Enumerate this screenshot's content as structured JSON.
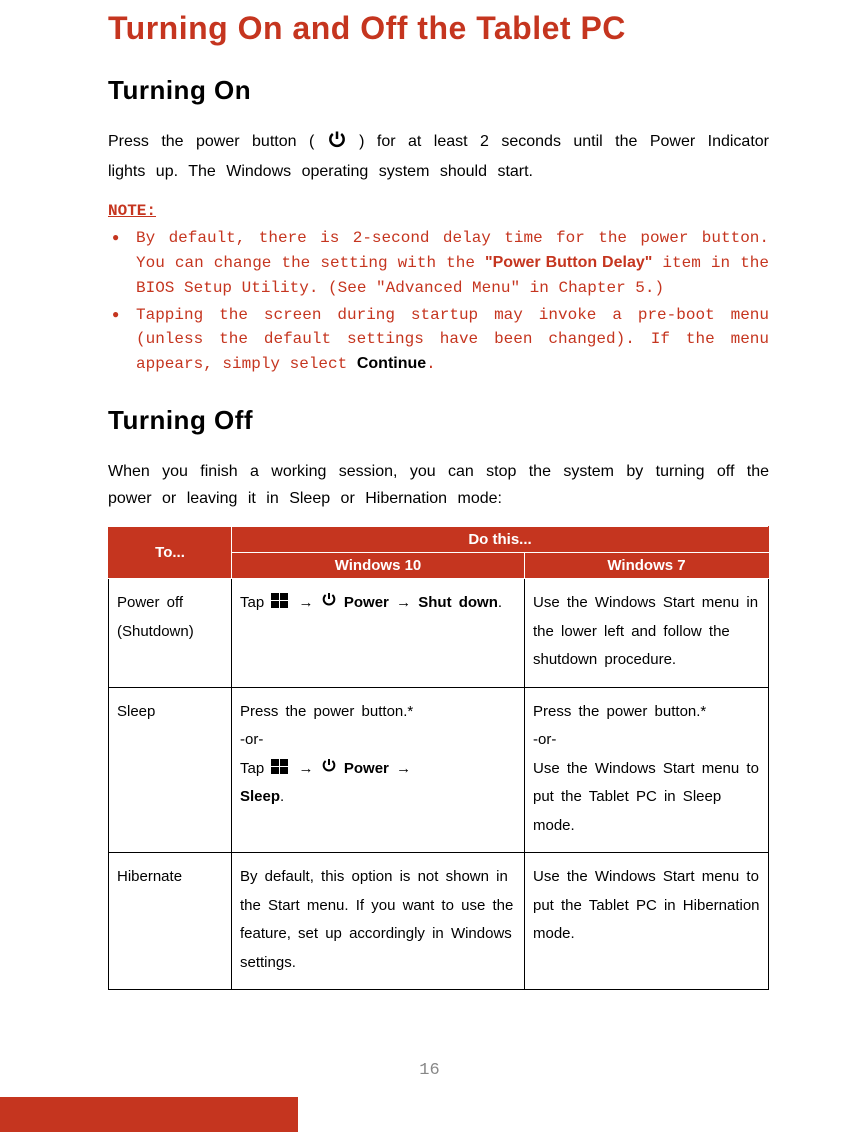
{
  "title": "Turning On and Off the Tablet PC",
  "section1": {
    "heading": "Turning On",
    "para_before": "Press the power button ( ",
    "para_after": " ) for at least 2 seconds until the Power Indicator lights up. The Windows operating system should start."
  },
  "note": {
    "label": "NOTE:",
    "items": [
      {
        "pre": "By default, there is 2-second delay time for the power button. You can change the setting with the ",
        "bold": "\"Power Button Delay\"",
        "post": " item in the BIOS Setup Utility. (See \"Advanced Menu\" in Chapter 5.)"
      },
      {
        "pre": "Tapping the screen during startup may invoke a pre-boot menu (unless the default settings have been changed). If the menu appears, simply select ",
        "bold": "Continue",
        "post": "."
      }
    ]
  },
  "section2": {
    "heading": "Turning Off",
    "para": "When you finish a working session, you can stop the system by turning off the power or leaving it in Sleep or Hibernation mode:"
  },
  "table": {
    "header_to": "To...",
    "header_do": "Do this...",
    "header_w10": "Windows 10",
    "header_w7": "Windows 7",
    "rows": [
      {
        "to": "Power off (Shutdown)",
        "w10_pre": "Tap ",
        "w10_mid": " Power ",
        "w10_post": " Shut down",
        "w10_tail": ".",
        "w7": "Use the Windows Start menu in the lower left and follow the shutdown procedure."
      },
      {
        "to": "Sleep",
        "w10_line1": "Press the power button.*",
        "w10_or": "-or-",
        "w10_pre": "Tap ",
        "w10_mid": " Power ",
        "w10_post": " Sleep",
        "w10_tail": ".",
        "w7_line1": "Press the power button.*",
        "w7_or": "-or-",
        "w7_line3": "Use the Windows Start menu to put the Tablet PC in Sleep mode."
      },
      {
        "to": "Hibernate",
        "w10": "By default, this option is not shown in the Start menu. If you want to use the feature, set up accordingly in Windows settings.",
        "w7": "Use the Windows Start menu to put the Tablet PC in Hibernation mode."
      }
    ]
  },
  "page_number": "16"
}
